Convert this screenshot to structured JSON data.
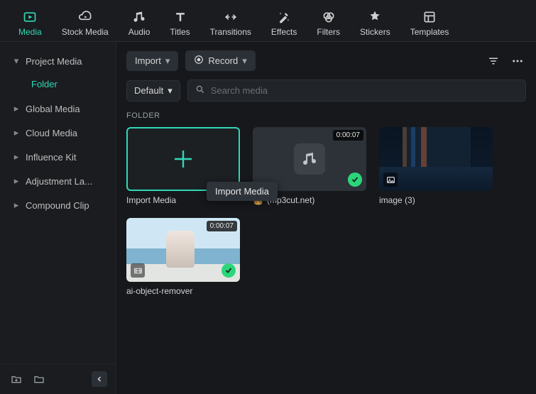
{
  "topnav": [
    {
      "label": "Media",
      "active": true
    },
    {
      "label": "Stock Media"
    },
    {
      "label": "Audio"
    },
    {
      "label": "Titles"
    },
    {
      "label": "Transitions"
    },
    {
      "label": "Effects"
    },
    {
      "label": "Filters"
    },
    {
      "label": "Stickers"
    },
    {
      "label": "Templates"
    }
  ],
  "sidebar": {
    "items": [
      {
        "label": "Project Media",
        "expanded": true,
        "children": [
          {
            "label": "Folder"
          }
        ]
      },
      {
        "label": "Global Media"
      },
      {
        "label": "Cloud Media"
      },
      {
        "label": "Influence Kit"
      },
      {
        "label": "Adjustment La..."
      },
      {
        "label": "Compound Clip"
      }
    ]
  },
  "toolbar": {
    "import_label": "Import",
    "record_label": "Record"
  },
  "search": {
    "sort_label": "Default",
    "placeholder": "Search media"
  },
  "section": {
    "label": "FOLDER"
  },
  "media": {
    "import_card": {
      "caption": "Import Media",
      "tooltip": "Import Media"
    },
    "items": [
      {
        "caption": "(mp3cut.net)",
        "duration": "0:00:07",
        "check": true,
        "type": "audio",
        "favicon": true
      },
      {
        "caption": "image (3)",
        "type": "image"
      },
      {
        "caption": "ai-object-remover",
        "duration": "0:00:07",
        "check": true,
        "type": "video"
      }
    ]
  }
}
